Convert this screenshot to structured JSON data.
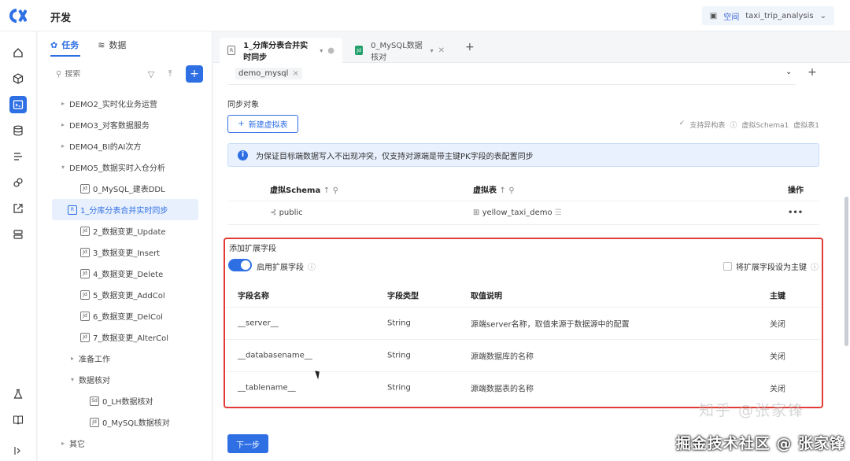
{
  "header": {
    "title": "开发",
    "workspace_label": "空间",
    "workspace_value": "taxi_trip_analysis"
  },
  "sidebar_tree": {
    "tabs": [
      {
        "label": "任务",
        "active": true
      },
      {
        "label": "数据",
        "active": false
      }
    ],
    "search_placeholder": "搜索",
    "add_label": "+",
    "items": [
      {
        "label": "DEMO2_实时化业务运营",
        "level": 0,
        "type": "folder"
      },
      {
        "label": "DEMO3_对客数据服务",
        "level": 0,
        "type": "folder"
      },
      {
        "label": "DEMO4_BI的AI次方",
        "level": 0,
        "type": "folder"
      },
      {
        "label": "DEMO5_数据实时入仓分析",
        "level": 0,
        "type": "folder-open"
      },
      {
        "label": "0_MySQL_建表DDL",
        "level": 1,
        "type": "file",
        "badge": "Jd"
      },
      {
        "label": "1_分库分表合并实时同步",
        "level": 1,
        "type": "file",
        "badge": "R",
        "selected": true
      },
      {
        "label": "2_数据变更_Update",
        "level": 1,
        "type": "file",
        "badge": "Jd"
      },
      {
        "label": "3_数据变更_Insert",
        "level": 1,
        "type": "file",
        "badge": "Jd"
      },
      {
        "label": "4_数据变更_Delete",
        "level": 1,
        "type": "file",
        "badge": "Jd"
      },
      {
        "label": "5_数据变更_AddCol",
        "level": 1,
        "type": "file",
        "badge": "Jd"
      },
      {
        "label": "6_数据变更_DelCol",
        "level": 1,
        "type": "file",
        "badge": "Jd"
      },
      {
        "label": "7_数据变更_AlterCol",
        "level": 1,
        "type": "file",
        "badge": "Jd"
      },
      {
        "label": "准备工作",
        "level": 1,
        "type": "folder"
      },
      {
        "label": "数据核对",
        "level": 1,
        "type": "folder-open"
      },
      {
        "label": "0_LH数据核对",
        "level": 2,
        "type": "file",
        "badge": "Sd"
      },
      {
        "label": "0_MySQL数据核对",
        "level": 2,
        "type": "file",
        "badge": "Jd"
      },
      {
        "label": "其它",
        "level": 0,
        "type": "folder"
      }
    ]
  },
  "tabs": [
    {
      "label": "1_分库分表合并实时同步",
      "badge": "R",
      "active": true
    },
    {
      "label": "0_MySQL数据核对",
      "badge": "Jd",
      "active": false
    }
  ],
  "datasource": {
    "tag": "demo_mysql"
  },
  "sync_objects": {
    "label": "同步对象",
    "new_button": "新建虚拟表",
    "meta": [
      "支持异构表",
      "虚拟Schema1",
      "虚拟表1"
    ]
  },
  "info_banner": "为保证目标端数据写入不出现冲突，仅支持对源端是带主键PK字段的表配置同步",
  "virtual_table": {
    "headers": [
      "虚拟Schema",
      "虚拟表",
      "操作"
    ],
    "rows": [
      {
        "schema": "public",
        "table": "yellow_taxi_demo",
        "action": "•••"
      }
    ]
  },
  "extension": {
    "title": "添加扩展字段",
    "toggle_label": "启用扩展字段",
    "toggle_on": true,
    "pk_label": "将扩展字段设为主键",
    "headers": [
      "字段名称",
      "字段类型",
      "取值说明",
      "主键"
    ],
    "rows": [
      {
        "name": "__server__",
        "type": "String",
        "desc": "源端server名称，取值来源于数据源中的配置",
        "pk": "关闭"
      },
      {
        "name": "__databasename__",
        "type": "String",
        "desc": "源端数据库的名称",
        "pk": "关闭"
      },
      {
        "name": "__tablename__",
        "type": "String",
        "desc": "源端数据表的名称",
        "pk": "关闭"
      }
    ]
  },
  "next_button": "下一步",
  "watermark": {
    "faint": "知乎 @张家锋",
    "bold": "掘金技术社区 @ 张家锋"
  },
  "colors": {
    "accent": "#2f6fe4",
    "highlight_border": "#e23a35",
    "banner_bg": "#e8f1fd"
  }
}
